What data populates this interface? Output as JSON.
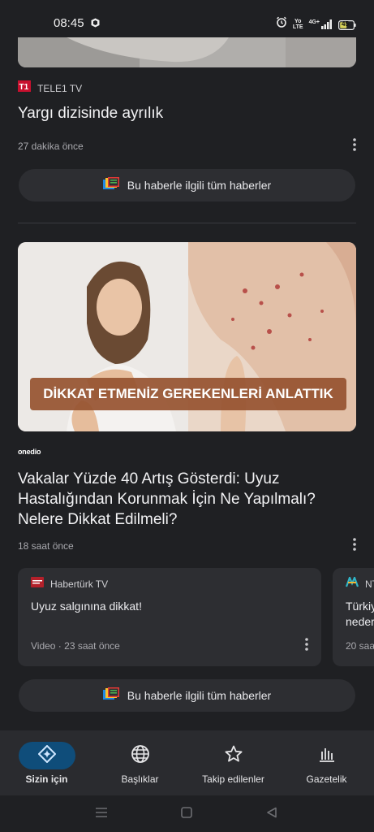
{
  "status_bar": {
    "time": "08:45",
    "battery": "45",
    "net_top": "Yo",
    "net_bottom": "LTE",
    "net_type": "4G+"
  },
  "article1": {
    "source": "TELE1 TV",
    "headline": "Yargı dizisinde ayrılık",
    "time": "27 dakika önce"
  },
  "related_button_label": "Bu haberle ilgili tüm haberler",
  "article2": {
    "image_banner": "DİKKAT ETMENİZ GEREKENLERİ ANLATTIK",
    "source_logo": "onedio",
    "headline": "Vakalar Yüzde 40 Artış Gösterdi: Uyuz Hastalığından Korunmak İçin Ne Yapılmalı? Nelere Dikkat Edilmeli?",
    "time": "18 saat önce"
  },
  "sub_cards": [
    {
      "source": "Habertürk TV",
      "title": "Uyuz salgınına dikkat!",
      "meta": "Video · 23 saat önce"
    },
    {
      "source": "NT",
      "title": "Türkiy",
      "title2": "neder",
      "meta": "20 saa"
    }
  ],
  "nav": {
    "items": [
      {
        "label": "Sizin için",
        "icon": "diamond-sparkle-icon",
        "active": true
      },
      {
        "label": "Başlıklar",
        "icon": "globe-icon",
        "active": false
      },
      {
        "label": "Takip edilenler",
        "icon": "star-icon",
        "active": false
      },
      {
        "label": "Gazetelik",
        "icon": "columns-icon",
        "active": false
      }
    ]
  },
  "colors": {
    "background": "#1f2023",
    "card": "#2d2e32",
    "nav_active": "#0f4d7a",
    "banner": "#965330"
  }
}
